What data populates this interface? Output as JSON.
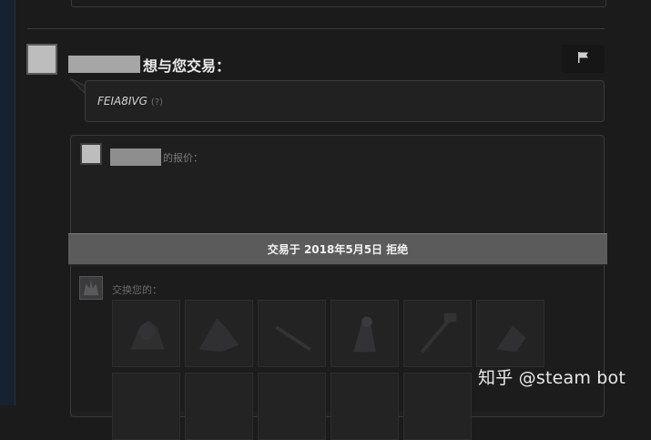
{
  "header": {
    "title_suffix": "想与您交易："
  },
  "message": {
    "text": "FEIA8IVG",
    "help": "(?)"
  },
  "offer": {
    "label": "的报价："
  },
  "status": {
    "text": "交易于 2018年5月5日 拒绝"
  },
  "exchange": {
    "label": "交换您的："
  },
  "watermark": {
    "text": "知乎 @steam bot"
  },
  "colors": {
    "status_bar": "#5b5b5c",
    "background": "#1b1b1c",
    "panel": "#1f1f20"
  }
}
